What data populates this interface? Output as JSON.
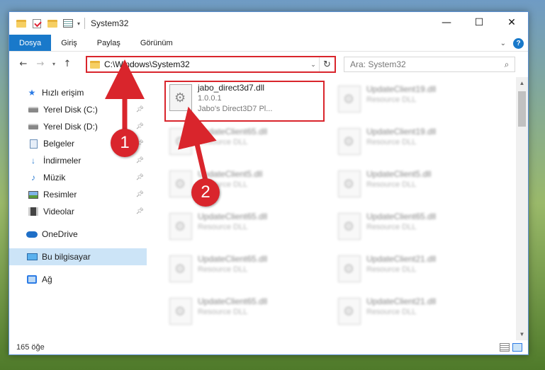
{
  "window": {
    "title": "System32",
    "controls": {
      "minimize": "—",
      "maximize": "☐",
      "close": "✕"
    }
  },
  "ribbon": {
    "tabs": [
      "Dosya",
      "Giriş",
      "Paylaş",
      "Görünüm"
    ],
    "help": "?"
  },
  "nav": {
    "back": "←",
    "forward": "→",
    "up": "↑",
    "address": "C:\\Windows\\System32",
    "refresh": "↻",
    "search_placeholder": "Ara: System32"
  },
  "sidebar": {
    "items": [
      {
        "label": "Hızlı erişim",
        "icon": "star-icon",
        "pinned": false
      },
      {
        "label": "Yerel Disk (C:)",
        "icon": "disk-icon",
        "pinned": true
      },
      {
        "label": "Yerel Disk (D:)",
        "icon": "disk-icon",
        "pinned": true
      },
      {
        "label": "Belgeler",
        "icon": "document-icon",
        "pinned": true
      },
      {
        "label": "İndirmeler",
        "icon": "download-icon",
        "pinned": true
      },
      {
        "label": "Müzik",
        "icon": "music-icon",
        "pinned": true
      },
      {
        "label": "Resimler",
        "icon": "pictures-icon",
        "pinned": true
      },
      {
        "label": "Videolar",
        "icon": "video-icon",
        "pinned": true
      },
      {
        "label": "OneDrive",
        "icon": "cloud-icon"
      },
      {
        "label": "Bu bilgisayar",
        "icon": "computer-icon",
        "selected": true
      },
      {
        "label": "Ağ",
        "icon": "network-icon"
      }
    ]
  },
  "files": {
    "main": {
      "name": "jabo_direct3d7.dll",
      "version": "1.0.0.1",
      "description": "Jabo's Direct3D7 Pl..."
    },
    "left_column": [
      {
        "name": "UpdateClient65.dll",
        "sub": "Resource DLL"
      },
      {
        "name": "UpdateClient5.dll",
        "sub": "Resource DLL"
      },
      {
        "name": "UpdateClient65.dll",
        "sub": "Resource DLL"
      },
      {
        "name": "UpdateClient65.dll",
        "sub": "Resource DLL"
      },
      {
        "name": "UpdateClient65.dll",
        "sub": "Resource DLL"
      }
    ],
    "right_column": [
      {
        "name": "UpdateClient19.dll",
        "sub": "Resource DLL"
      },
      {
        "name": "UpdateClient19.dll",
        "sub": "Resource DLL"
      },
      {
        "name": "UpdateClient5.dll",
        "sub": "Resource DLL"
      },
      {
        "name": "UpdateClient65.dll",
        "sub": "Resource DLL"
      },
      {
        "name": "UpdateClient21.dll",
        "sub": "Resource DLL"
      },
      {
        "name": "UpdateClient21.dll",
        "sub": "Resource DLL"
      }
    ]
  },
  "status": {
    "count": "165 öğe"
  },
  "annotations": {
    "step1": "1",
    "step2": "2",
    "accent": "#d9252c"
  }
}
